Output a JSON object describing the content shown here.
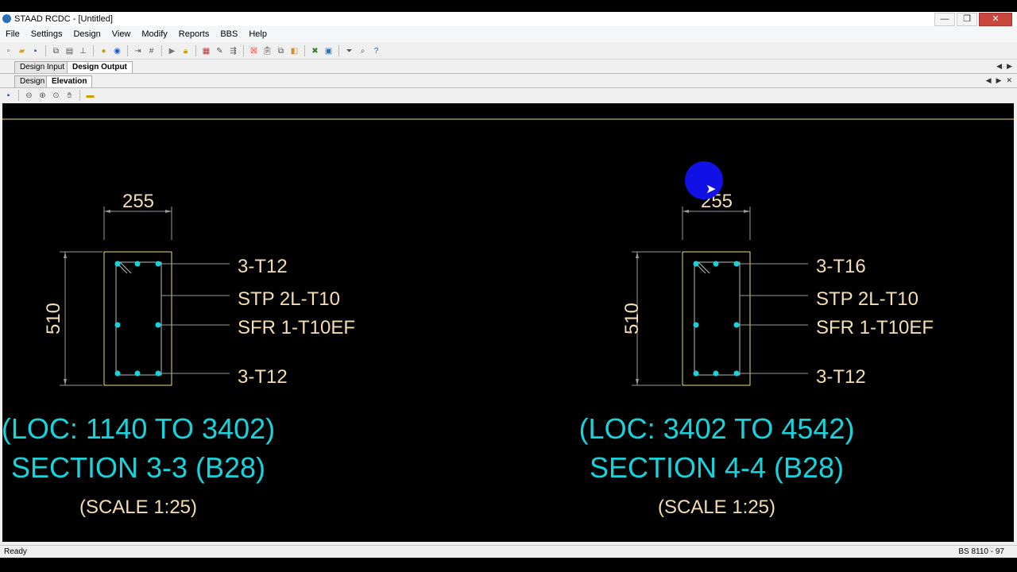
{
  "window": {
    "title": "STAAD RCDC - [Untitled]",
    "controls": [
      "—",
      "❐",
      "✕"
    ]
  },
  "menu": {
    "items": [
      "File",
      "Settings",
      "Design",
      "View",
      "Modify",
      "Reports",
      "BBS",
      "Help"
    ]
  },
  "tabs_top": [
    "Design Input",
    "Design Output"
  ],
  "tabs_sub": [
    "Design",
    "Elevation"
  ],
  "sections": [
    {
      "width_dim": "255",
      "depth_dim": "510",
      "top_bars": "3-T12",
      "stirrups": "STP 2L-T10",
      "side_face": "SFR 1-T10EF",
      "bottom_bars": "3-T12",
      "location": "(LOC: 1140 TO 3402)",
      "title": "SECTION 3-3 (B28)",
      "scale": "(SCALE 1:25)"
    },
    {
      "width_dim": "255",
      "depth_dim": "510",
      "top_bars": "3-T16",
      "stirrups": "STP 2L-T10",
      "side_face": "SFR 1-T10EF",
      "bottom_bars": "3-T12",
      "location": "(LOC: 3402 TO 4542)",
      "title": "SECTION 4-4 (B28)",
      "scale": "(SCALE 1:25)"
    }
  ],
  "colors": {
    "text": "#f5deb3",
    "cyan": "#19d3dc",
    "beam_outline": "#e8e07a",
    "dim_line": "#9a9a9a"
  },
  "status": {
    "left": "Ready",
    "right": "BS 8110 - 97"
  }
}
